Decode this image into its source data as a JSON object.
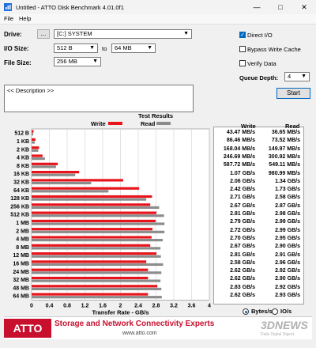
{
  "window": {
    "title": "Untitled - ATTO Disk Benchmark 4.01.0f1",
    "minimize_glyph": "—",
    "maximize_glyph": "□",
    "close_glyph": "✕"
  },
  "menu": {
    "file": "File",
    "help": "Help"
  },
  "controls": {
    "drive_label": "Drive:",
    "browse_label": "...",
    "drive_value": "[C:] SYSTEM",
    "io_size_label": "I/O Size:",
    "io_from": "512 B",
    "io_to_label": "to",
    "io_to": "64 MB",
    "file_size_label": "File Size:",
    "file_size": "256 MB",
    "direct_io_label": "Direct I/O",
    "direct_io_checked": true,
    "bypass_cache_label": "Bypass Write Cache",
    "bypass_cache_checked": false,
    "verify_label": "Verify Data",
    "verify_checked": false,
    "queue_depth_label": "Queue Depth:",
    "queue_depth": "4",
    "start_label": "Start",
    "description": "<< Description >>"
  },
  "chart": {
    "title": "Test Results",
    "write_label": "Write",
    "read_label": "Read",
    "write_color": "#e8141b",
    "read_color": "#8c8c8c",
    "xlabel": "Transfer Rate - GB/s",
    "xticks": [
      "0",
      "0.4",
      "0.8",
      "1.2",
      "1.6",
      "2",
      "2.4",
      "2.8",
      "3.2",
      "3.6",
      "4"
    ],
    "xlim": [
      0,
      4
    ],
    "unit_bytes_label": "Bytes/s",
    "unit_io_label": "IO/s",
    "unit_selected": "bytes"
  },
  "chart_data": {
    "type": "bar",
    "title": "Test Results",
    "xlabel": "Transfer Rate - GB/s",
    "xlim": [
      0,
      4
    ],
    "categories": [
      "512 B",
      "1 KB",
      "2 KB",
      "4 KB",
      "8 KB",
      "16 KB",
      "32 KB",
      "64 KB",
      "128 KB",
      "256 KB",
      "512 KB",
      "1 MB",
      "2 MB",
      "4 MB",
      "8 MB",
      "12 MB",
      "16 MB",
      "24 MB",
      "32 MB",
      "48 MB",
      "64 MB"
    ],
    "series": [
      {
        "name": "Write",
        "values": [
          0.04347,
          0.08646,
          0.16804,
          0.24669,
          0.58772,
          1.07,
          2.06,
          2.42,
          2.71,
          2.67,
          2.81,
          2.79,
          2.72,
          2.7,
          2.67,
          2.81,
          2.58,
          2.62,
          2.62,
          2.83,
          2.62
        ]
      },
      {
        "name": "Read",
        "values": [
          0.03665,
          0.07352,
          0.14997,
          0.30092,
          0.54911,
          0.98099,
          1.34,
          1.73,
          2.58,
          2.87,
          2.98,
          2.99,
          2.99,
          2.95,
          2.9,
          2.91,
          2.96,
          2.92,
          2.9,
          2.92,
          2.93
        ]
      }
    ]
  },
  "results": {
    "write_header": "Write",
    "read_header": "Read",
    "rows": [
      [
        "43.47 MB/s",
        "36.65 MB/s"
      ],
      [
        "86.46 MB/s",
        "73.52 MB/s"
      ],
      [
        "168.04 MB/s",
        "149.97 MB/s"
      ],
      [
        "246.69 MB/s",
        "300.92 MB/s"
      ],
      [
        "587.72 MB/s",
        "549.11 MB/s"
      ],
      [
        "1.07 GB/s",
        "980.99 MB/s"
      ],
      [
        "2.06 GB/s",
        "1.34 GB/s"
      ],
      [
        "2.42 GB/s",
        "1.73 GB/s"
      ],
      [
        "2.71 GB/s",
        "2.58 GB/s"
      ],
      [
        "2.67 GB/s",
        "2.87 GB/s"
      ],
      [
        "2.81 GB/s",
        "2.98 GB/s"
      ],
      [
        "2.79 GB/s",
        "2.99 GB/s"
      ],
      [
        "2.72 GB/s",
        "2.99 GB/s"
      ],
      [
        "2.70 GB/s",
        "2.95 GB/s"
      ],
      [
        "2.67 GB/s",
        "2.90 GB/s"
      ],
      [
        "2.81 GB/s",
        "2.91 GB/s"
      ],
      [
        "2.58 GB/s",
        "2.96 GB/s"
      ],
      [
        "2.62 GB/s",
        "2.92 GB/s"
      ],
      [
        "2.62 GB/s",
        "2.90 GB/s"
      ],
      [
        "2.83 GB/s",
        "2.92 GB/s"
      ],
      [
        "2.62 GB/s",
        "2.93 GB/s"
      ]
    ]
  },
  "banner": {
    "logo": "ATTO",
    "tagline": "Storage and Network Connectivity Experts",
    "url": "www.atto.com",
    "watermark": "3DNEWS",
    "watermark_sub": "Daily Digital Digest"
  }
}
